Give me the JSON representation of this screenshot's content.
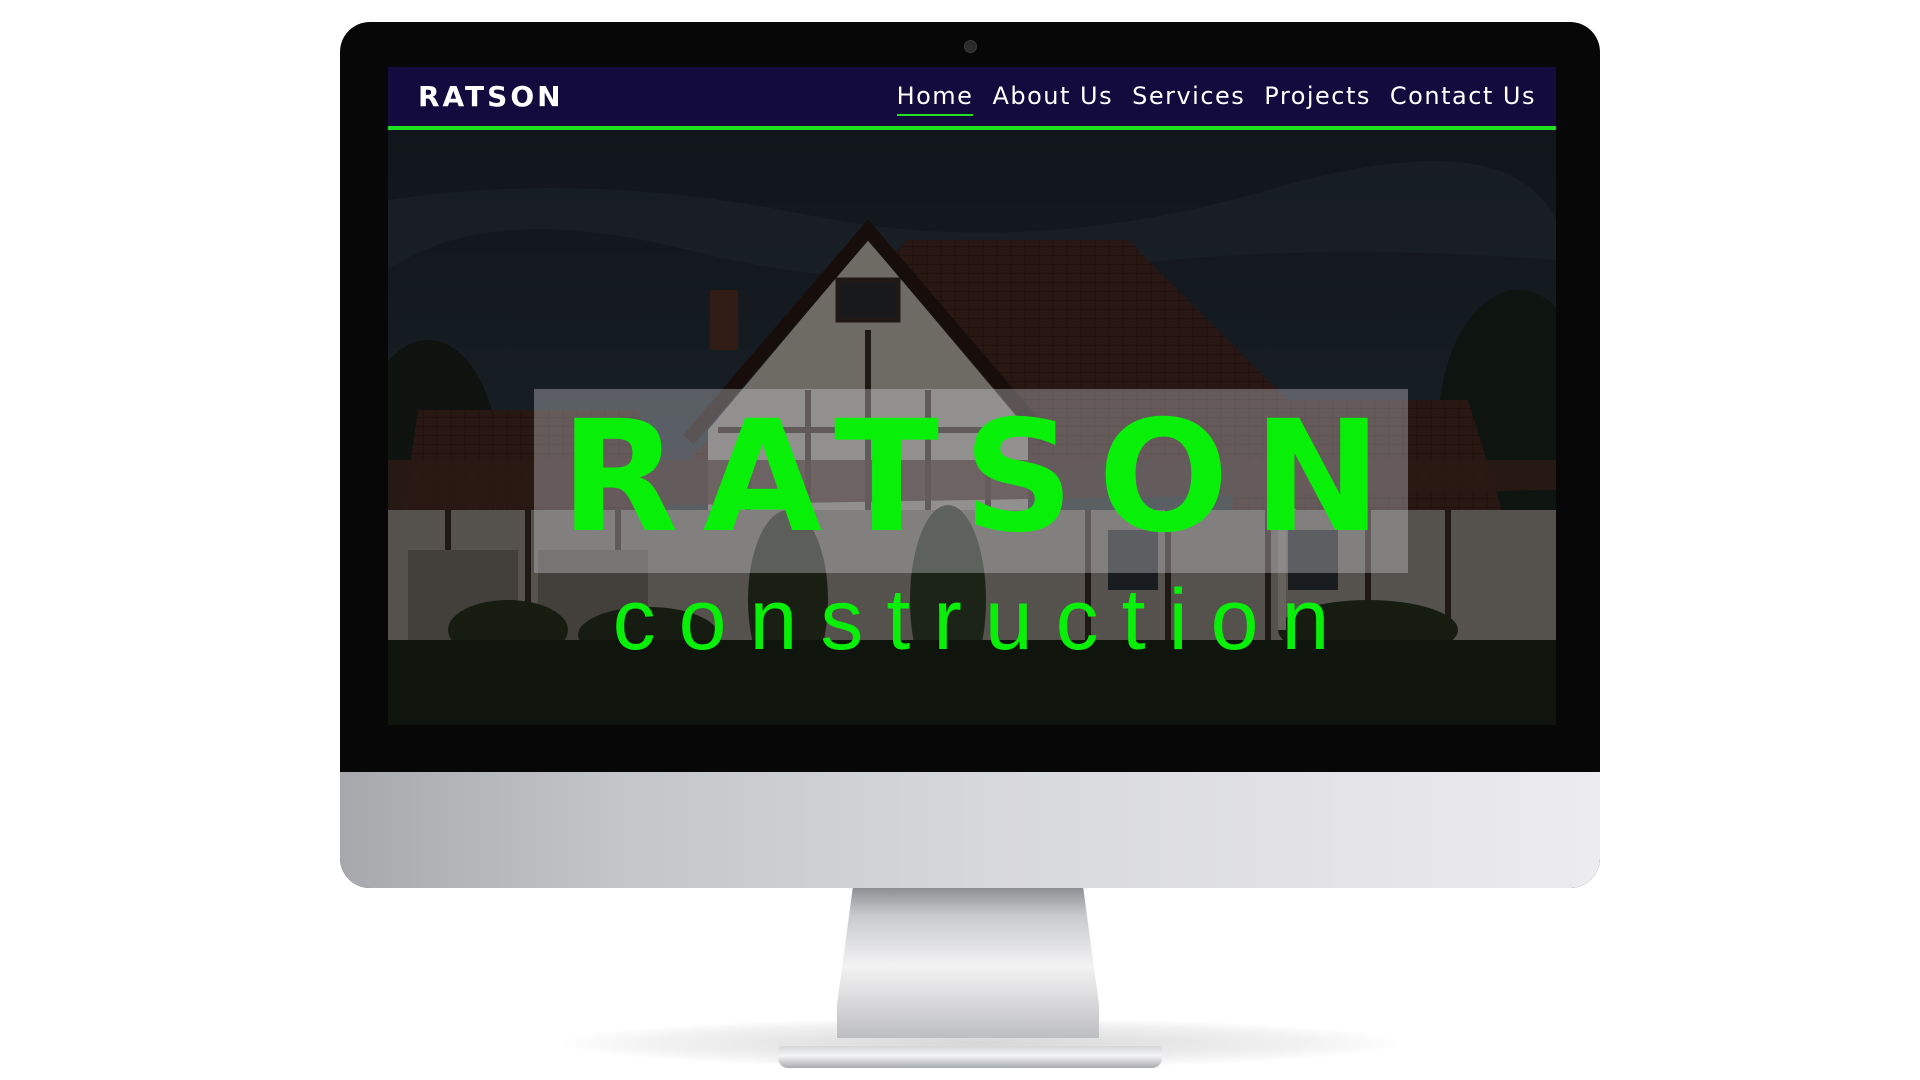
{
  "site": {
    "brand": "RATSON",
    "nav": [
      {
        "label": "Home",
        "active": true
      },
      {
        "label": "About Us",
        "active": false
      },
      {
        "label": "Services",
        "active": false
      },
      {
        "label": "Projects",
        "active": false
      },
      {
        "label": "Contact Us",
        "active": false
      }
    ],
    "hero": {
      "title": "RATSON",
      "subtitle": "construction"
    }
  },
  "colors": {
    "navbar_background": "#130a3d",
    "accent_green": "#1fe21f",
    "hero_text_green": "#08f008",
    "monitor_frame": "#070707"
  }
}
